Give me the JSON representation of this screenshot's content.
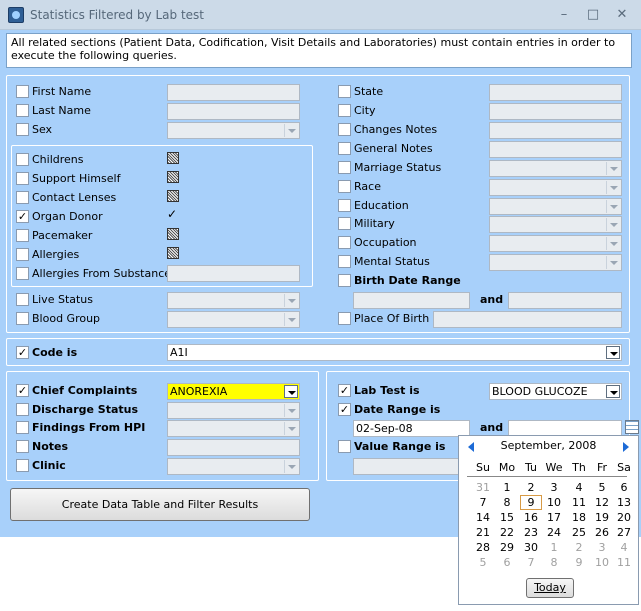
{
  "window": {
    "title": "Statistics Filtered by Lab test",
    "minimize": "–",
    "maximize": "□",
    "close": "✕"
  },
  "info_text": "All related sections (Patient Data, Codification, Visit Details and Laboratories) must contain entries in order to execute the following queries.",
  "patient_left": {
    "first_name": "First Name",
    "last_name": "Last Name",
    "sex": "Sex"
  },
  "flags": {
    "childrens": "Childrens",
    "support_himself": "Support Himself",
    "contact_lenses": "Contact Lenses",
    "organ_donor": "Organ Donor",
    "pacemaker": "Pacemaker",
    "allergies": "Allergies",
    "allergies_from_substance": "Allergies From Substance:"
  },
  "patient_left2": {
    "live_status": "Live Status",
    "blood_group": "Blood Group"
  },
  "patient_right": {
    "state": "State",
    "city": "City",
    "changes_notes": "Changes Notes",
    "general_notes": "General Notes",
    "marriage_status": "Marriage Status",
    "race": "Race",
    "education": "Education",
    "military": "Military",
    "occupation": "Occupation",
    "mental_status": "Mental Status",
    "birth_date_range": "Birth Date Range",
    "and": "and",
    "place_of_birth": "Place Of Birth"
  },
  "code": {
    "label": "Code  is",
    "value": "A1I"
  },
  "visit": {
    "chief_complaints": "Chief Complaints",
    "chief_complaints_value": "ANOREXIA",
    "discharge_status": "Discharge Status",
    "findings_from_hpi": "Findings From HPI",
    "notes": "Notes",
    "clinic": "Clinic"
  },
  "lab": {
    "lab_test_label": "Lab Test  is",
    "lab_test_value": "BLOOD GLUCOZE",
    "date_range_label": "Date Range is",
    "date_from": "02-Sep-08",
    "and": "and",
    "value_range_label": "Value Range is"
  },
  "create_button": "Create Data Table and Filter Results",
  "calendar": {
    "month_year": "September, 2008",
    "days_of_week": [
      "Su",
      "Mo",
      "Tu",
      "We",
      "Th",
      "Fr",
      "Sa"
    ],
    "weeks": [
      [
        "31",
        "1",
        "2",
        "3",
        "4",
        "5",
        "6"
      ],
      [
        "7",
        "8",
        "9",
        "10",
        "11",
        "12",
        "13"
      ],
      [
        "14",
        "15",
        "16",
        "17",
        "18",
        "19",
        "20"
      ],
      [
        "21",
        "22",
        "23",
        "24",
        "25",
        "26",
        "27"
      ],
      [
        "28",
        "29",
        "30",
        "1",
        "2",
        "3",
        "4"
      ],
      [
        "5",
        "6",
        "7",
        "8",
        "9",
        "10",
        "11"
      ]
    ],
    "selected_day": "9",
    "today_label": "Today"
  },
  "colors": {
    "form_background": "#a8d0fa",
    "highlight_yellow": "#ffff00"
  }
}
